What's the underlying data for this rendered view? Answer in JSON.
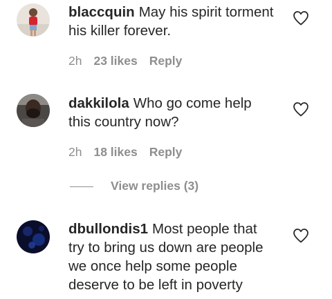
{
  "comments": [
    {
      "username": "blaccquin",
      "text": "May his spirit torment his killer forever.",
      "time": "2h",
      "likes": "23 likes",
      "reply": "Reply"
    },
    {
      "username": "dakkilola",
      "text": "Who go come help this country now?",
      "time": "2h",
      "likes": "18 likes",
      "reply": "Reply",
      "view_replies": "View replies (3)"
    },
    {
      "username": "dbullondis1",
      "text": "Most people that try to bring us down are people we once help some people deserve to be left in poverty"
    }
  ],
  "icons": {
    "heart": "heart-outline-icon"
  },
  "colors": {
    "text": "#262626",
    "secondary": "#8e8e8e",
    "background": "#ffffff"
  }
}
